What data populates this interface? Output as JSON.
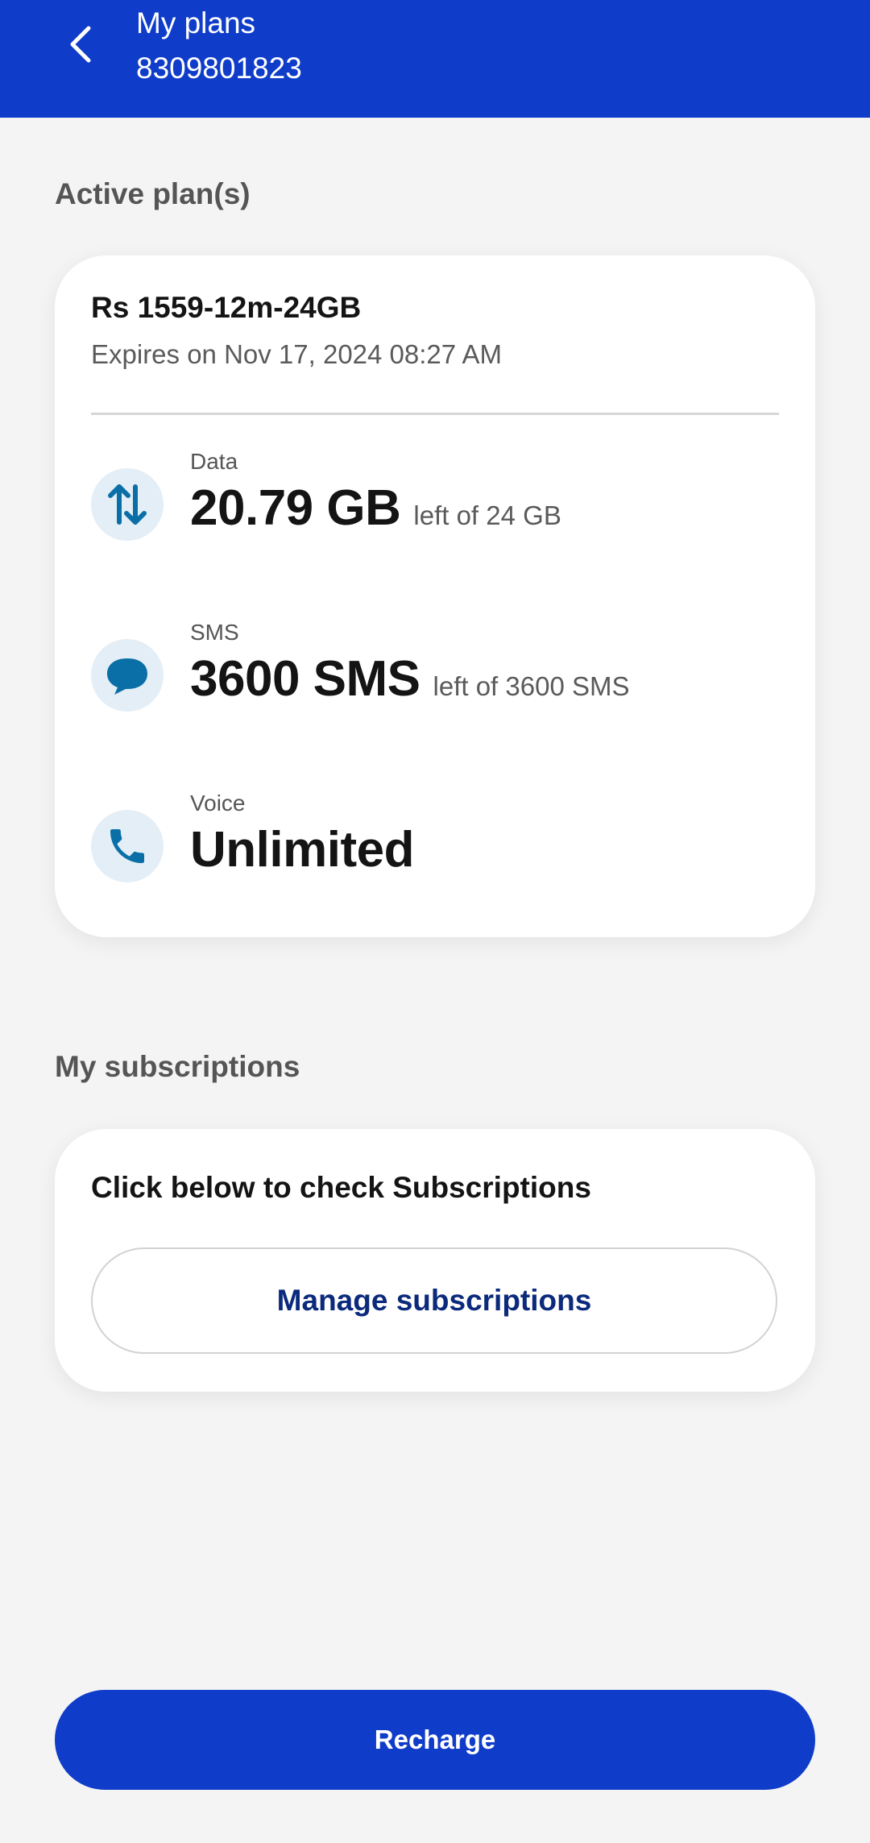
{
  "header": {
    "title": "My plans",
    "phone_number": "8309801823",
    "background_color": "#0f3cc9",
    "back_icon": "chevron-left-icon"
  },
  "active_plans": {
    "heading": "Active plan(s)",
    "plan": {
      "name": "Rs 1559-12m-24GB",
      "expiry": "Expires on Nov 17, 2024 08:27 AM",
      "benefits": [
        {
          "label": "Data",
          "value": "20.79 GB",
          "suffix": "left of 24 GB",
          "icon": "data-arrows-icon"
        },
        {
          "label": "SMS",
          "value": "3600 SMS",
          "suffix": "left of 3600 SMS",
          "icon": "chat-bubble-icon"
        },
        {
          "label": "Voice",
          "value": "Unlimited",
          "icon": "phone-icon"
        }
      ]
    }
  },
  "subscriptions": {
    "heading": "My subscriptions",
    "prompt": "Click below to check Subscriptions",
    "button_label": "Manage subscriptions"
  },
  "footer": {
    "recharge_label": "Recharge"
  },
  "colors": {
    "brand_blue": "#0f3cc9",
    "icon_blue": "#0a6fa6",
    "icon_bg": "#e4eef6",
    "page_bg": "#f4f4f4"
  }
}
